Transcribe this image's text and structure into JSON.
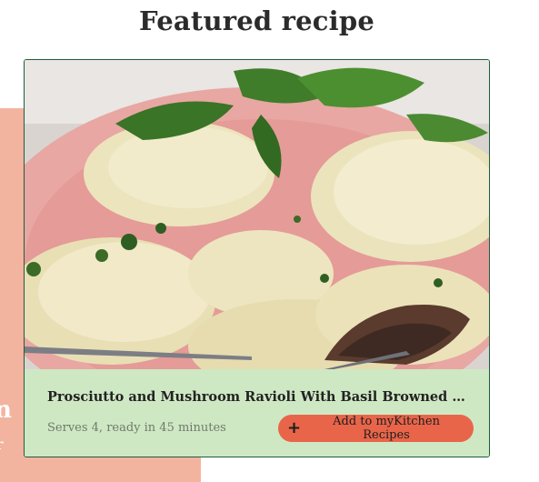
{
  "section": {
    "heading": "Featured recipe"
  },
  "recipe": {
    "title": "Prosciutto and Mushroom Ravioli With Basil Browned Butter S...",
    "meta": "Serves 4, ready in 45 minutes",
    "photo_icon": "ravioli-photo"
  },
  "actions": {
    "add_label": "Add to myKitchen Recipes",
    "add_icon": "plus-icon",
    "plus_glyph": "+"
  },
  "colors": {
    "accent": "#e8654a",
    "card_bg": "#cfe8c4",
    "panel": "#f3b49f",
    "card_border": "#1f5c3f"
  },
  "background_panel": {
    "fragment_1": "n",
    "fragment_2": "r"
  }
}
